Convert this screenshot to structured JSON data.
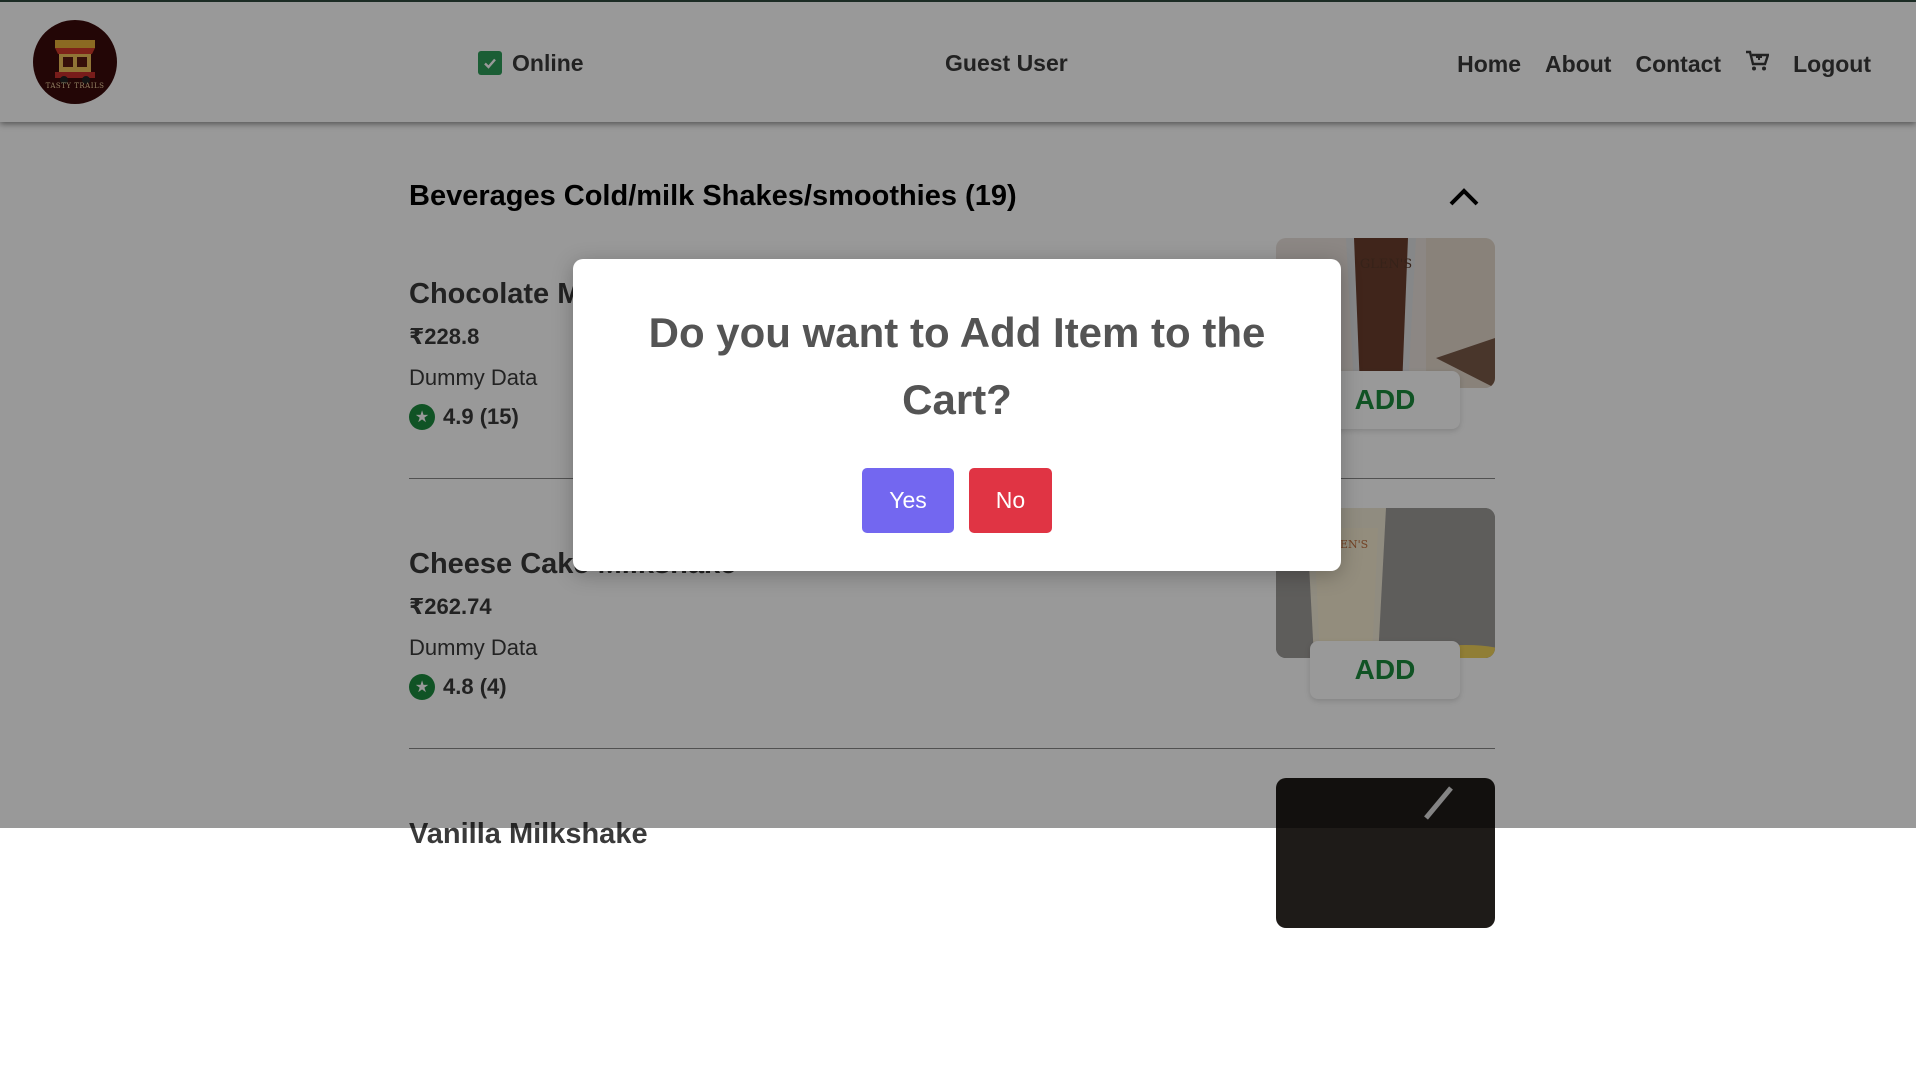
{
  "header": {
    "logo_text": "TASTY TRAILS",
    "status_label": "Online",
    "user_name": "Guest User",
    "nav": {
      "home": "Home",
      "about": "About",
      "contact": "Contact",
      "cart_icon": "cart-icon",
      "logout": "Logout"
    }
  },
  "category": {
    "title": "Beverages Cold/milk Shakes/smoothies (19)",
    "items": [
      {
        "name": "Chocolate Milkshake",
        "price": "₹228.8",
        "description": "Dummy Data",
        "rating": "4.9 (15)",
        "add_label": "ADD",
        "cup_text": "GLEN'S"
      },
      {
        "name": "Cheese Cake Milkshake",
        "price": "₹262.74",
        "description": "Dummy Data",
        "rating": "4.8 (4)",
        "add_label": "ADD",
        "cup_text": "GLEN'S"
      },
      {
        "name": "Vanilla Milkshake"
      }
    ]
  },
  "dialog": {
    "message": "Do you want to Add Item to the Cart?",
    "yes_label": "Yes",
    "no_label": "No"
  },
  "colors": {
    "yes_button": "#7367f0",
    "no_button": "#e03444",
    "add_text": "#1b8a3d",
    "online_check": "#2e9d59"
  }
}
